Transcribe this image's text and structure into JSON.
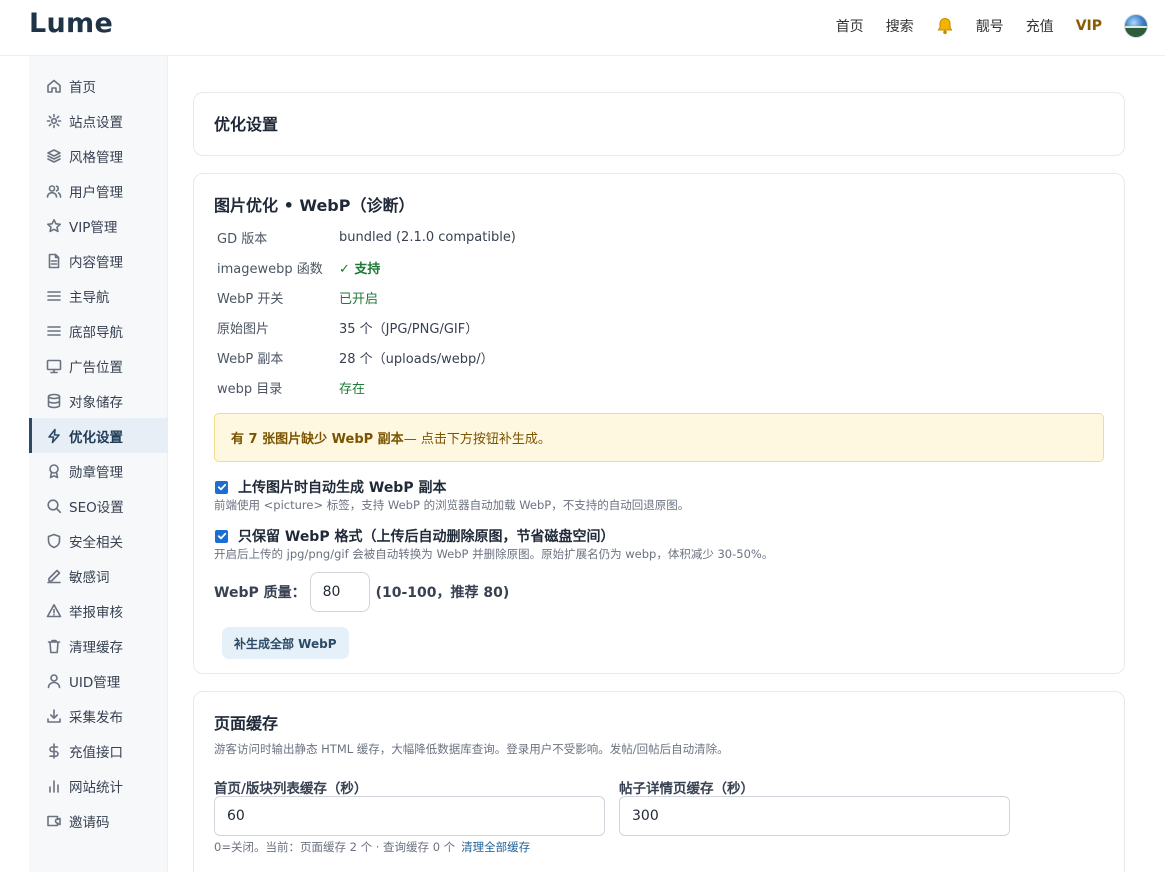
{
  "header": {
    "brand": "Lume",
    "nav": [
      "首页",
      "搜索",
      "靓号",
      "充值"
    ],
    "vip": "VIP"
  },
  "sidebar": {
    "items": [
      {
        "label": "首页",
        "icon": "home-icon"
      },
      {
        "label": "站点设置",
        "icon": "gear-icon"
      },
      {
        "label": "风格管理",
        "icon": "layers-icon"
      },
      {
        "label": "用户管理",
        "icon": "users-icon"
      },
      {
        "label": "VIP管理",
        "icon": "star-icon"
      },
      {
        "label": "内容管理",
        "icon": "document-icon"
      },
      {
        "label": "主导航",
        "icon": "menu-icon"
      },
      {
        "label": "底部导航",
        "icon": "menu-icon"
      },
      {
        "label": "广告位置",
        "icon": "monitor-icon"
      },
      {
        "label": "对象储存",
        "icon": "database-icon"
      },
      {
        "label": "优化设置",
        "icon": "lightning-icon"
      },
      {
        "label": "勋章管理",
        "icon": "award-icon"
      },
      {
        "label": "SEO设置",
        "icon": "search-icon"
      },
      {
        "label": "安全相关",
        "icon": "shield-icon"
      },
      {
        "label": "敏感词",
        "icon": "pen-icon"
      },
      {
        "label": "举报审核",
        "icon": "warning-icon"
      },
      {
        "label": "清理缓存",
        "icon": "trash-icon"
      },
      {
        "label": "UID管理",
        "icon": "user-icon"
      },
      {
        "label": "采集发布",
        "icon": "download-icon"
      },
      {
        "label": "充值接口",
        "icon": "dollar-icon"
      },
      {
        "label": "网站统计",
        "icon": "bar-chart-icon"
      },
      {
        "label": "邀请码",
        "icon": "ticket-icon"
      }
    ],
    "active_index": 10
  },
  "page": {
    "title": "优化设置"
  },
  "webp": {
    "title": "图片优化 • WebP（诊断）",
    "rows": [
      {
        "key": "GD 版本",
        "value": "bundled (2.1.0 compatible)",
        "status": "plain"
      },
      {
        "key": "imagewebp 函数",
        "value": "✓ 支持",
        "status": "ok-bold"
      },
      {
        "key": "WebP 开关",
        "value": "已开启",
        "status": "ok"
      },
      {
        "key": "原始图片",
        "value": "35 个（JPG/PNG/GIF）",
        "status": "plain"
      },
      {
        "key": "WebP 副本",
        "value": "28 个（uploads/webp/）",
        "status": "plain"
      },
      {
        "key": "webp 目录",
        "value": "存在",
        "status": "ok"
      }
    ],
    "alert_bold": "有 7 张图片缺少 WebP 副本",
    "alert_rest": " — 点击下方按钮补生成。",
    "opt1_label": "上传图片时自动生成 WebP 副本",
    "opt1_hint": "前端使用 <picture> 标签，支持 WebP 的浏览器自动加载 WebP，不支持的自动回退原图。",
    "opt2_label": "只保留 WebP 格式（上传后自动删除原图，节省磁盘空间）",
    "opt2_hint": "开启后上传的 jpg/png/gif 会被自动转换为 WebP 并删除原图。原始扩展名仍为 webp，体积减少 30-50%。",
    "quality_label": "WebP 质量：",
    "quality_value": "80",
    "quality_note": "(10-100，推荐 80)",
    "regen_button": "补生成全部 WebP"
  },
  "cache": {
    "title": "页面缓存",
    "desc": "游客访问时输出静态 HTML 缓存，大幅降低数据库查询。登录用户不受影响。发帖/回帖后自动清除。",
    "list_label": "首页/版块列表缓存（秒）",
    "list_value": "60",
    "detail_label": "帖子详情页缓存（秒）",
    "detail_value": "300",
    "foot": "0=关闭。当前：页面缓存 2 个 · 查询缓存 0 个",
    "clear_link": "清理全部缓存"
  }
}
